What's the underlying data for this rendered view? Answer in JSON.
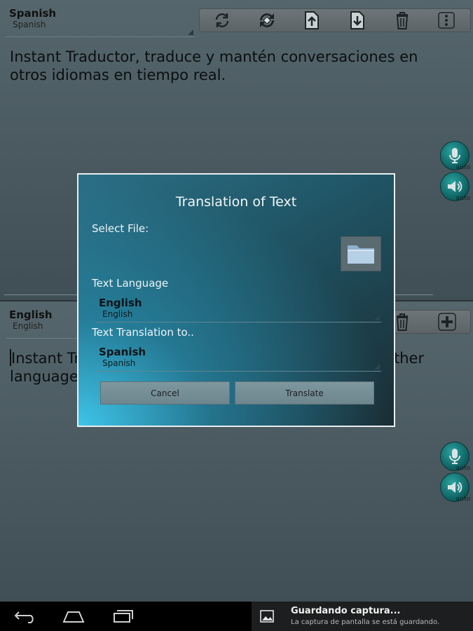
{
  "top_panel": {
    "language": {
      "main": "Spanish",
      "sub": "Spanish"
    },
    "text": "Instant Traductor, traduce y mantén conversaciones en otros idiomas en tiempo real."
  },
  "toolbar": {
    "icons": [
      "refresh-icon",
      "swap-icon",
      "upload-icon",
      "download-icon",
      "trash-icon",
      "overflow-menu-icon"
    ]
  },
  "bottom_panel": {
    "language": {
      "main": "English",
      "sub": "English"
    },
    "text_left_line1": "Instant Tr",
    "text_left_line2": "languages",
    "text_right_line1": "ther"
  },
  "round_buttons": {
    "auto_label": "auto"
  },
  "dialog": {
    "title": "Translation of Text",
    "select_file_label": "Select File:",
    "text_language_label": "Text Language",
    "text_language": {
      "main": "English",
      "sub": "English"
    },
    "translation_to_label": "Text Translation to..",
    "translation_to": {
      "main": "Spanish",
      "sub": "Spanish"
    },
    "cancel_label": "Cancel",
    "translate_label": "Translate"
  },
  "notification": {
    "title": "Guardando captura...",
    "text": "La captura de pantalla se está guardando."
  },
  "colors": {
    "accent": "#2aa3a0",
    "dialog_glow": "#3ec4e8"
  }
}
